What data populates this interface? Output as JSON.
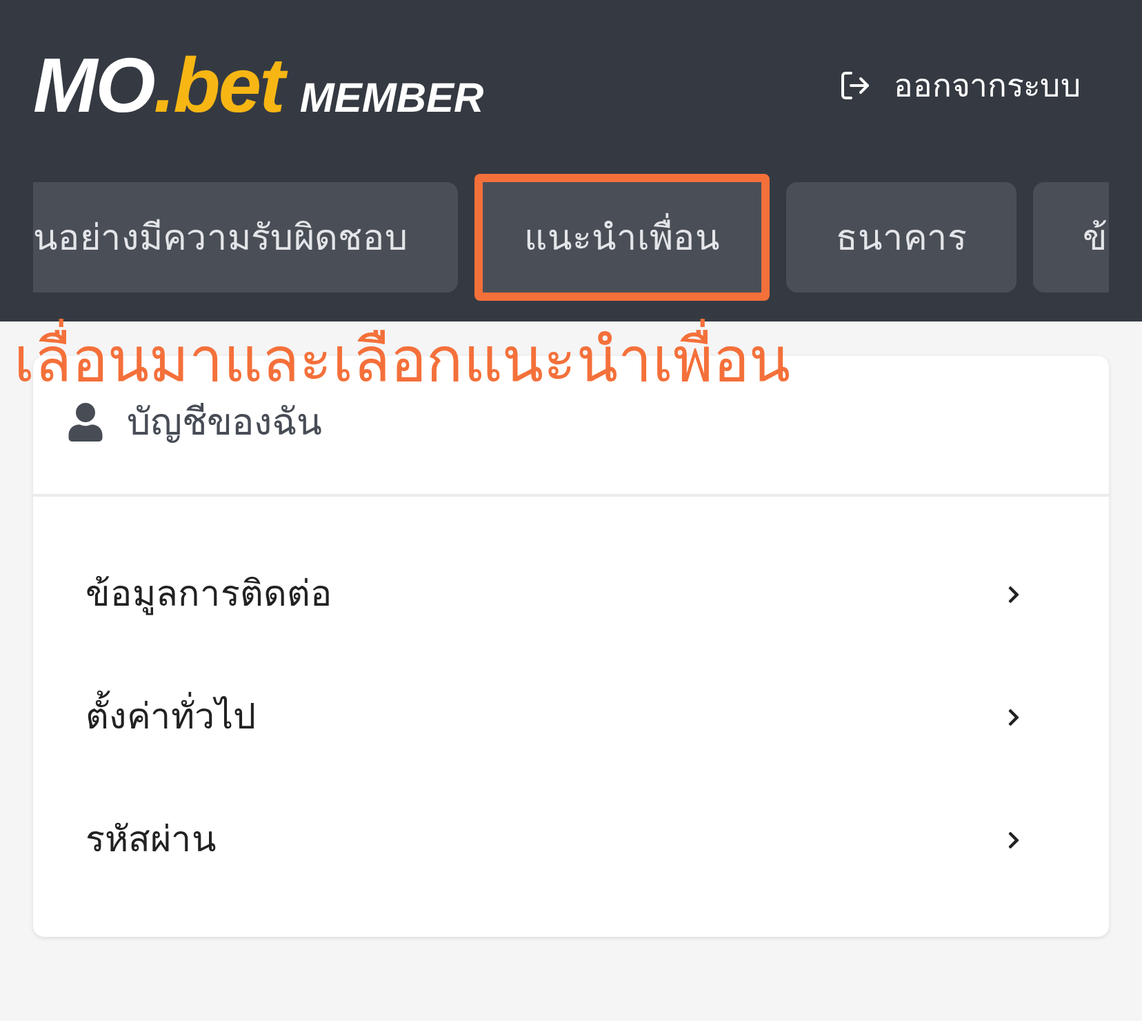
{
  "header": {
    "logo": {
      "part_1": "MO",
      "part_2": ".bet",
      "part_3": "MEMBER"
    },
    "logout": "ออกจากระบบ"
  },
  "tabs": [
    {
      "label": "นอย่างมีความรับผิดชอบ",
      "selected": false
    },
    {
      "label": "แนะนำเพื่อน",
      "selected": true
    },
    {
      "label": "ธนาคาร",
      "selected": false
    },
    {
      "label": "ข้",
      "selected": false
    }
  ],
  "annotation": "เลื่อนมาและเลือกแนะนำเพื่อน",
  "account_card": {
    "title": "บัญชีของฉัน",
    "items": [
      "ข้อมูลการติดต่อ",
      "ตั้งค่าทั่วไป",
      "รหัสผ่าน"
    ]
  }
}
